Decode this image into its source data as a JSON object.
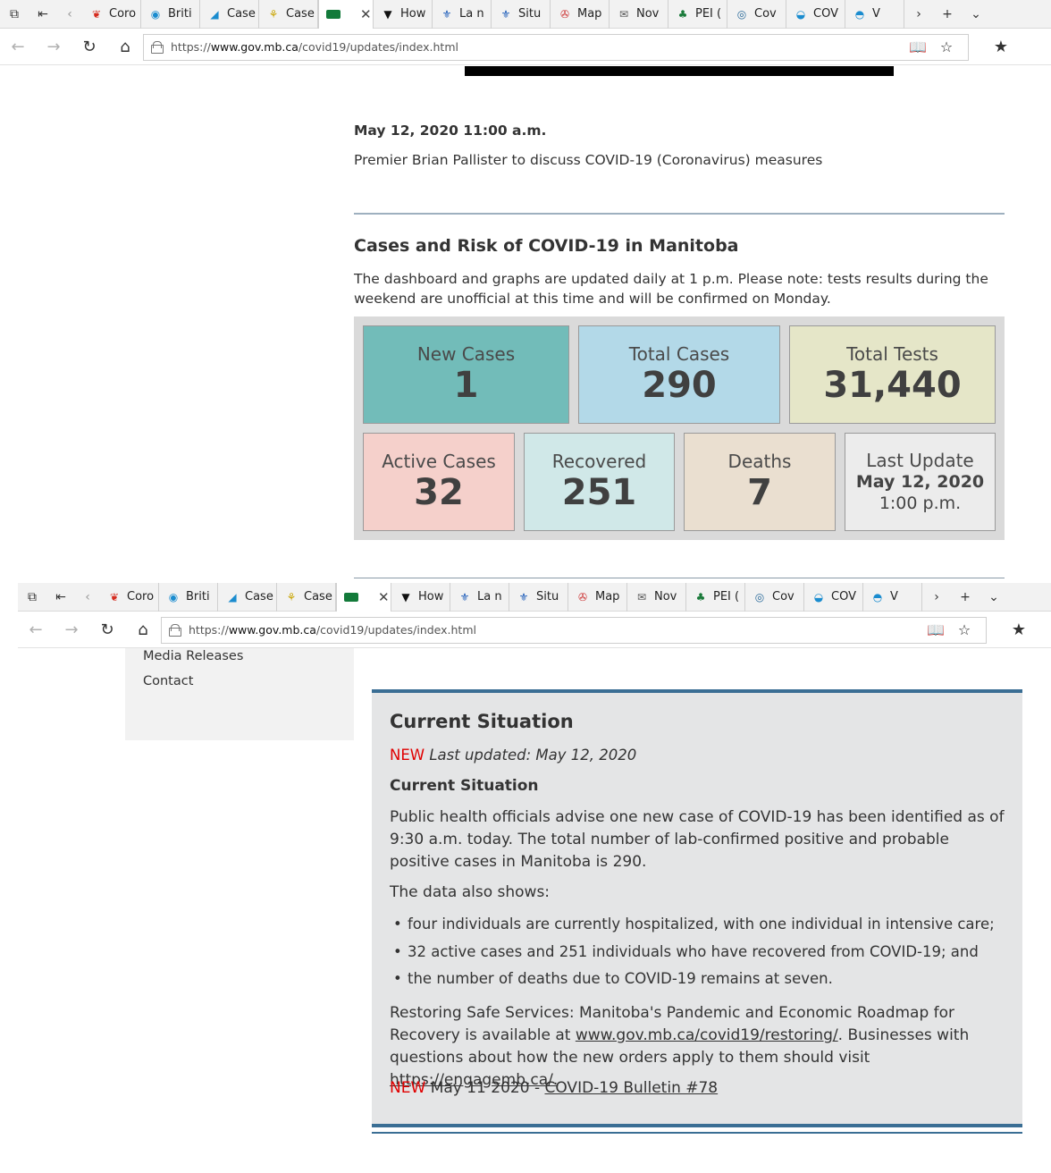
{
  "browser": {
    "tabs_top": [
      {
        "label": "Coro",
        "icon": "maple-leaf-icon",
        "color": "#d52b1e"
      },
      {
        "label": "Briti",
        "icon": "bc-icon",
        "color": "#1a8ccf"
      },
      {
        "label": "Case",
        "icon": "alberta-icon",
        "color": "#1a8ccf"
      },
      {
        "label": "Case",
        "icon": "sask-icon",
        "color": "#c8a400"
      },
      {
        "label": "",
        "icon": "manitoba-icon",
        "color": "#137a3a",
        "active": true
      },
      {
        "label": "How",
        "icon": "ontario-icon",
        "color": "#111111"
      },
      {
        "label": "La n",
        "icon": "quebec-icon",
        "color": "#1a5ab8"
      },
      {
        "label": "Situ",
        "icon": "quebec-icon",
        "color": "#1a5ab8"
      },
      {
        "label": "Map",
        "icon": "nb-icon",
        "color": "#c33"
      },
      {
        "label": "Nov",
        "icon": "ns-icon",
        "color": "#555"
      },
      {
        "label": "PEI (",
        "icon": "pei-icon",
        "color": "#1a7a3a"
      },
      {
        "label": "Cov",
        "icon": "nl-icon",
        "color": "#2a6a9a"
      },
      {
        "label": "COV",
        "icon": "yukon-icon",
        "color": "#1a8ccf"
      },
      {
        "label": "V",
        "icon": "nwt-icon",
        "color": "#1a8ccf"
      }
    ],
    "tabs_bottom": [
      {
        "label": "Coro",
        "icon": "maple-leaf-icon",
        "color": "#d52b1e"
      },
      {
        "label": "Briti",
        "icon": "bc-icon",
        "color": "#1a8ccf"
      },
      {
        "label": "Case",
        "icon": "alberta-icon",
        "color": "#1a8ccf"
      },
      {
        "label": "Case",
        "icon": "sask-icon",
        "color": "#c8a400"
      },
      {
        "label": "",
        "icon": "manitoba-icon",
        "color": "#137a3a",
        "active": true
      },
      {
        "label": "How",
        "icon": "ontario-icon",
        "color": "#111111"
      },
      {
        "label": "La n",
        "icon": "quebec-icon",
        "color": "#1a5ab8"
      },
      {
        "label": "Situ",
        "icon": "quebec-icon",
        "color": "#1a5ab8"
      },
      {
        "label": "Map",
        "icon": "nb-icon",
        "color": "#c33"
      },
      {
        "label": "Nov",
        "icon": "ns-icon",
        "color": "#555"
      },
      {
        "label": "PEI (",
        "icon": "pei-icon",
        "color": "#1a7a3a"
      },
      {
        "label": "Cov",
        "icon": "nl-icon",
        "color": "#2a6a9a"
      },
      {
        "label": "COV",
        "icon": "yukon-icon",
        "color": "#1a8ccf"
      },
      {
        "label": "V",
        "icon": "nwt-icon",
        "color": "#1a8ccf"
      }
    ],
    "url_prefix": "https://",
    "url_host": "www.gov.mb.ca",
    "url_path": "/covid19/updates/index.html"
  },
  "news": {
    "date": "May 12, 2020 11:00 a.m.",
    "headline": "Premier Brian Pallister to discuss COVID-19 (Coronavirus) measures"
  },
  "cases": {
    "heading": "Cases and Risk of COVID-19 in Manitoba",
    "note": "The dashboard and graphs are updated daily at 1 p.m. Please note: tests results during the weekend are unofficial at this time and will be confirmed on Monday.",
    "tiles": {
      "new_cases": {
        "label": "New Cases",
        "value": "1",
        "color": "#72bcb9"
      },
      "total_cases": {
        "label": "Total Cases",
        "value": "290",
        "color": "#b3d9e8"
      },
      "total_tests": {
        "label": "Total Tests",
        "value": "31,440",
        "color": "#e5e6c8"
      },
      "active_cases": {
        "label": "Active Cases",
        "value": "32",
        "color": "#f5d0cb"
      },
      "recovered": {
        "label": "Recovered",
        "value": "251",
        "color": "#d0e8e8"
      },
      "deaths": {
        "label": "Deaths",
        "value": "7",
        "color": "#eadfd0"
      },
      "last_update": {
        "label": "Last Update",
        "date": "May 12, 2020",
        "time": "1:00 p.m.",
        "color": "#ececec"
      }
    }
  },
  "sidebar": {
    "items": [
      "Media Releases",
      "Contact"
    ]
  },
  "situation": {
    "title": "Current Situation",
    "new_tag": "NEW",
    "updated": "Last updated: May 12, 2020",
    "subtitle": "Current Situation",
    "para1": "Public health officials advise one new case of COVID-19 has been identified as of 9:30 a.m. today. The total number of lab-confirmed positive and probable positive cases in Manitoba is 290.",
    "para2": "The data also shows:",
    "bullets": [
      "four individuals are currently hospitalized, with one individual in intensive care;",
      "32 active cases and 251 individuals who have recovered from COVID-19; and",
      "the number of deaths due to COVID-19 remains at seven."
    ],
    "para3_start": "Restoring Safe Services: Manitoba's Pandemic and Economic Roadmap for Recovery is available at ",
    "link1": "www.gov.mb.ca/covid19/restoring/",
    "para3_mid": ". Businesses with questions about how the new orders apply to them should visit ",
    "link2": "https://engagemb.ca/.",
    "bulletin_prefix": "May 11 2020 - ",
    "bulletin_link": "COVID-19 Bulletin #78"
  }
}
